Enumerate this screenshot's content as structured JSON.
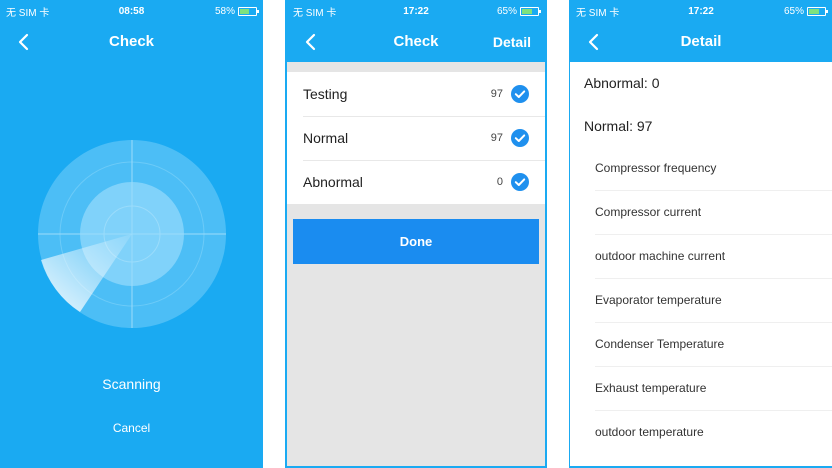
{
  "colors": {
    "primary": "#1aaaf2",
    "button": "#1a8cf0",
    "check": "#1f90ee"
  },
  "screens": [
    {
      "status": {
        "carrier": "无 SIM 卡",
        "time": "08:58",
        "battery": "58%",
        "battery_level": 0.58
      },
      "nav": {
        "title": "Check"
      },
      "scanning": "Scanning",
      "cancel": "Cancel"
    },
    {
      "status": {
        "carrier": "无 SIM 卡",
        "time": "17:22",
        "battery": "65%",
        "battery_level": 0.65
      },
      "nav": {
        "title": "Check",
        "action": "Detail"
      },
      "rows": [
        {
          "label": "Testing",
          "count": "97"
        },
        {
          "label": "Normal",
          "count": "97"
        },
        {
          "label": "Abnormal",
          "count": "0"
        }
      ],
      "done": "Done"
    },
    {
      "status": {
        "carrier": "无 SIM 卡",
        "time": "17:22",
        "battery": "65%",
        "battery_level": 0.65
      },
      "nav": {
        "title": "Detail"
      },
      "abnormal": "Abnormal: 0",
      "normal": "Normal: 97",
      "items": [
        "Compressor frequency",
        "Compressor current",
        "outdoor machine current",
        "Evaporator temperature",
        "Condenser Temperature",
        "Exhaust temperature",
        "outdoor temperature"
      ]
    }
  ]
}
